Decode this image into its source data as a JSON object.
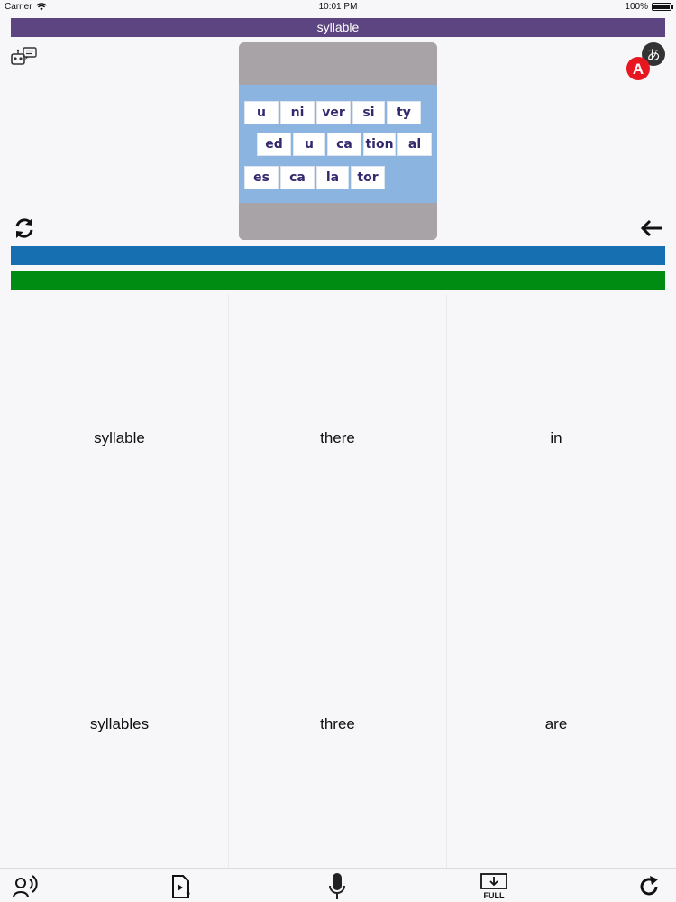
{
  "status_bar": {
    "carrier": "Carrier",
    "time": "10:01 PM",
    "battery": "100%",
    "battery_level": 1.0
  },
  "title": "syllable",
  "icons": {
    "top_left": "robot-chat-icon",
    "top_right": "translate-icon",
    "left_middle": "refresh-cycle-icon",
    "right_middle": "back-arrow-icon"
  },
  "image_card": {
    "rows": [
      [
        "u",
        "ni",
        "ver",
        "si",
        "ty"
      ],
      [
        "ed",
        "u",
        "ca",
        "tion",
        "al"
      ],
      [
        "es",
        "ca",
        "la",
        "tor"
      ]
    ]
  },
  "colors": {
    "title_bar": "#5c4580",
    "bar_blue": "#156fb0",
    "bar_green": "#008c12",
    "translate_badge": "#e8171f"
  },
  "word_choices": [
    "syllable",
    "there",
    "in",
    "syllables",
    "three",
    "are"
  ],
  "toolbar": {
    "items": [
      "speak-icon",
      "video-help-icon",
      "microphone-icon",
      "full-download-icon",
      "reload-icon"
    ],
    "full_label": "FULL"
  }
}
